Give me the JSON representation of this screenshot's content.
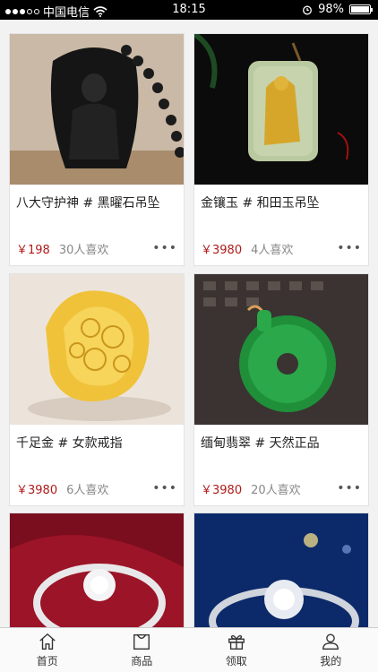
{
  "status_bar": {
    "carrier": "中国电信",
    "time": "18:15",
    "battery": "98%",
    "battery_level": 0.98
  },
  "products": [
    {
      "title": "八大守护神 # 黑曜石吊坠",
      "price": "￥198",
      "likes": "30人喜欢",
      "image": "obsidian-pendant"
    },
    {
      "title": "金镶玉 # 和田玉吊坠",
      "price": "￥3980",
      "likes": "4人喜欢",
      "image": "gold-jade-pendant"
    },
    {
      "title": "千足金 # 女款戒指",
      "price": "￥3980",
      "likes": "6人喜欢",
      "image": "gold-ring"
    },
    {
      "title": "缅甸翡翠 # 天然正品",
      "price": "￥3980",
      "likes": "20人喜欢",
      "image": "jade-pendant"
    },
    {
      "title": "",
      "price": "",
      "likes": "",
      "image": "silver-ring-red"
    },
    {
      "title": "",
      "price": "",
      "likes": "",
      "image": "diamond-ring-blue"
    }
  ],
  "tab_bar": {
    "items": [
      {
        "label": "首页",
        "icon": "home-icon"
      },
      {
        "label": "商品",
        "icon": "bag-icon"
      },
      {
        "label": "领取",
        "icon": "gift-icon"
      },
      {
        "label": "我的",
        "icon": "user-icon"
      }
    ]
  },
  "colors": {
    "price": "#b01a1a",
    "status_bar": "#000000"
  }
}
